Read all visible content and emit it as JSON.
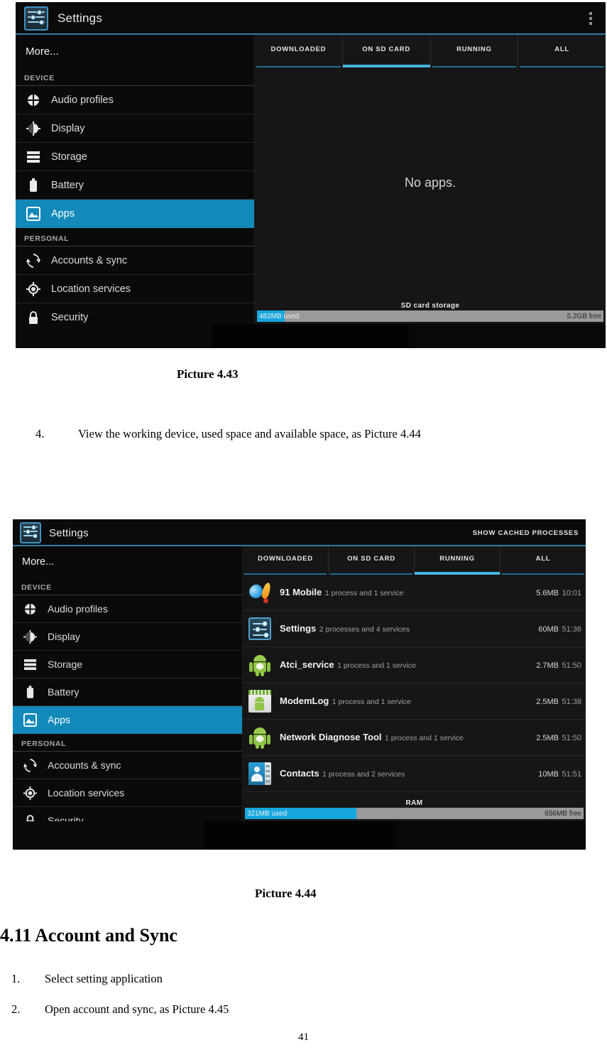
{
  "screenshot_1": {
    "app_title": "Settings",
    "overflow_menu": "overflow-menu",
    "sidebar": {
      "more_label": "More...",
      "section_device": "DEVICE",
      "section_personal": "PERSONAL",
      "items_device": [
        {
          "label": "Audio profiles",
          "icon": "audio-profiles-icon"
        },
        {
          "label": "Display",
          "icon": "display-icon"
        },
        {
          "label": "Storage",
          "icon": "storage-icon"
        },
        {
          "label": "Battery",
          "icon": "battery-icon"
        },
        {
          "label": "Apps",
          "icon": "apps-icon",
          "selected": true
        }
      ],
      "items_personal": [
        {
          "label": "Accounts & sync",
          "icon": "sync-icon"
        },
        {
          "label": "Location services",
          "icon": "location-icon"
        },
        {
          "label": "Security",
          "icon": "lock-icon"
        }
      ]
    },
    "tabs": [
      {
        "label": "DOWNLOADED",
        "active": false
      },
      {
        "label": "ON SD CARD",
        "active": true
      },
      {
        "label": "RUNNING",
        "active": false
      },
      {
        "label": "ALL",
        "active": false
      }
    ],
    "empty_message": "No apps.",
    "meter": {
      "title": "SD card storage",
      "used_label": "482MB used",
      "free_label": "5.2GB free",
      "used_percent": 8
    }
  },
  "screenshot_2": {
    "app_title": "Settings",
    "action_label": "SHOW CACHED PROCESSES",
    "sidebar": {
      "more_label": "More...",
      "section_device": "DEVICE",
      "section_personal": "PERSONAL",
      "items_device": [
        {
          "label": "Audio profiles",
          "icon": "audio-profiles-icon"
        },
        {
          "label": "Display",
          "icon": "display-icon"
        },
        {
          "label": "Storage",
          "icon": "storage-icon"
        },
        {
          "label": "Battery",
          "icon": "battery-icon"
        },
        {
          "label": "Apps",
          "icon": "apps-icon",
          "selected": true
        }
      ],
      "items_personal": [
        {
          "label": "Accounts & sync",
          "icon": "sync-icon"
        },
        {
          "label": "Location services",
          "icon": "location-icon"
        },
        {
          "label": "Security",
          "icon": "lock-icon"
        }
      ]
    },
    "tabs": [
      {
        "label": "DOWNLOADED",
        "active": false
      },
      {
        "label": "ON SD CARD",
        "active": false
      },
      {
        "label": "RUNNING",
        "active": true
      },
      {
        "label": "ALL",
        "active": false
      }
    ],
    "running_apps": [
      {
        "name": "91 Mobile",
        "detail": "1 process and 1 service",
        "size": "5.6MB",
        "time": "10:01",
        "icon": "app-91-mobile-icon"
      },
      {
        "name": "Settings",
        "detail": "2 processes and 4 services",
        "size": "60MB",
        "time": "51:36",
        "icon": "app-settings-icon"
      },
      {
        "name": "Atci_service",
        "detail": "1 process and 1 service",
        "size": "2.7MB",
        "time": "51:50",
        "icon": "app-android-icon"
      },
      {
        "name": "ModemLog",
        "detail": "1 process and 1 service",
        "size": "2.5MB",
        "time": "51:38",
        "icon": "app-modemlog-icon"
      },
      {
        "name": "Network Diagnose Tool",
        "detail": "1 process and 1 service",
        "size": "2.5MB",
        "time": "51:50",
        "icon": "app-android-icon"
      },
      {
        "name": "Contacts",
        "detail": "1 process and 2 services",
        "size": "10MB",
        "time": "51:51",
        "icon": "app-contacts-icon"
      }
    ],
    "meter": {
      "title": "RAM",
      "used_label": "321MB used",
      "free_label": "656MB free",
      "used_percent": 33
    }
  },
  "document": {
    "caption_1": "Picture 4.43",
    "step_4_number": "4.",
    "step_4_text": "View the working device, used space and available space, as Picture 4.44",
    "caption_2": "Picture 4.44",
    "heading": "4.11 Account and Sync",
    "step_1_number": "1.",
    "step_1_text": "Select setting application",
    "step_2_number": "2.",
    "step_2_text": "Open account and sync, as Picture 4.45",
    "page_number": "41"
  },
  "colors": {
    "accent_blue": "#1289b9",
    "tab_active": "#44b3e0",
    "meter_fill": "#16a7dd",
    "meter_track": "#9a9a9a"
  }
}
